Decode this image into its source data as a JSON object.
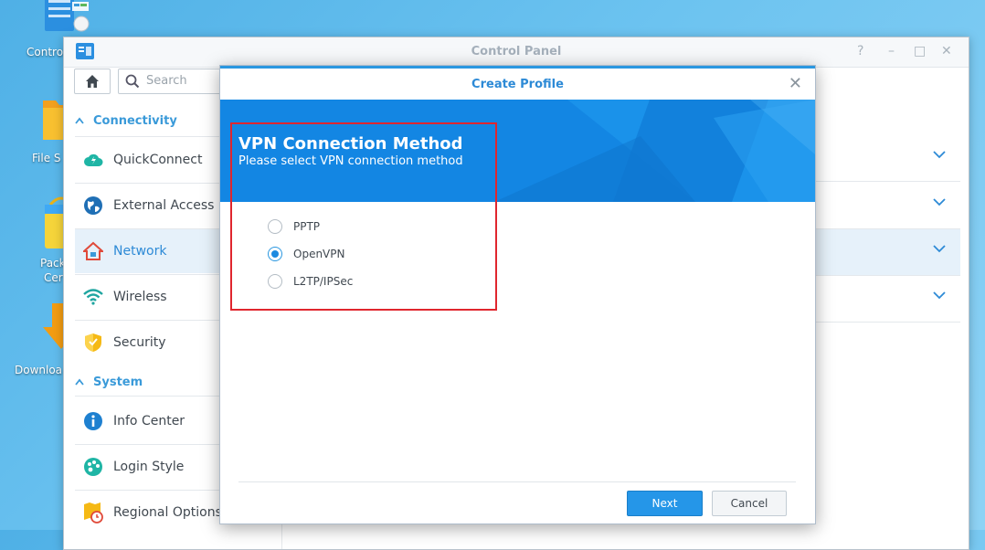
{
  "desktop": {
    "icons": [
      {
        "name": "control-panel",
        "label": "Control"
      },
      {
        "name": "file-station",
        "label": "File S"
      },
      {
        "name": "package-center",
        "label_line1": "Pack",
        "label_line2": "Cer"
      },
      {
        "name": "download-station",
        "label": "Downloa"
      }
    ]
  },
  "window": {
    "title": "Control Panel",
    "controls": {
      "help": "?",
      "minimize": "–",
      "maximize": "□",
      "close": "✕"
    }
  },
  "search": {
    "placeholder": "Search"
  },
  "sidebar": {
    "groups": [
      {
        "label": "Connectivity"
      },
      {
        "label": "System"
      }
    ],
    "items": [
      {
        "label": "QuickConnect"
      },
      {
        "label": "External Access"
      },
      {
        "label": "Network"
      },
      {
        "label": "Wireless"
      },
      {
        "label": "Security"
      },
      {
        "label": "Info Center"
      },
      {
        "label": "Login Style"
      },
      {
        "label": "Regional Options"
      }
    ],
    "active_item": "Network"
  },
  "modal": {
    "title": "Create Profile",
    "close": "✕",
    "banner": {
      "title": "VPN Connection Method",
      "subtitle": "Please select VPN connection method"
    },
    "options": [
      {
        "label": "PPTP",
        "checked": false
      },
      {
        "label": "OpenVPN",
        "checked": true
      },
      {
        "label": "L2TP/IPSec",
        "checked": false
      }
    ],
    "buttons": {
      "next": "Next",
      "cancel": "Cancel"
    }
  },
  "colors": {
    "accent": "#2a97e0",
    "banner": "#1386e3",
    "highlight": "#e0262e",
    "active_row": "#e6f1fa"
  }
}
